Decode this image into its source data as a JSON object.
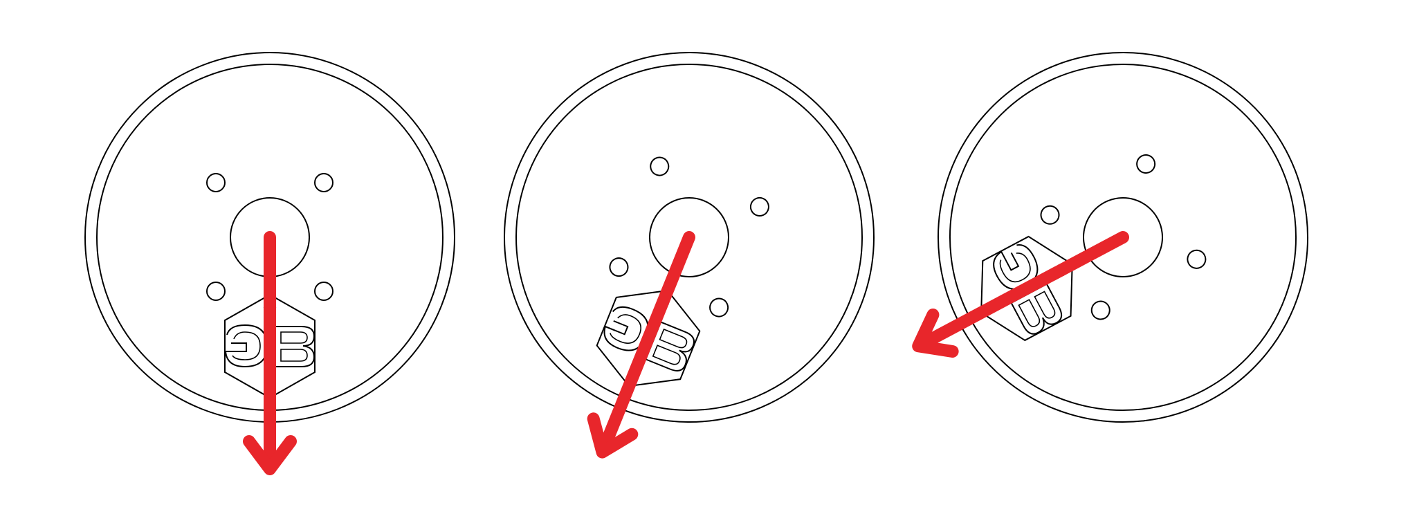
{
  "colors": {
    "background": "#ffffff",
    "outline": "#000000",
    "arrow": "#e8262b"
  },
  "panels": [
    {
      "orientation_deg": 0
    },
    {
      "orientation_deg": 22
    },
    {
      "orientation_deg": 62
    }
  ],
  "logo_text": "GB"
}
